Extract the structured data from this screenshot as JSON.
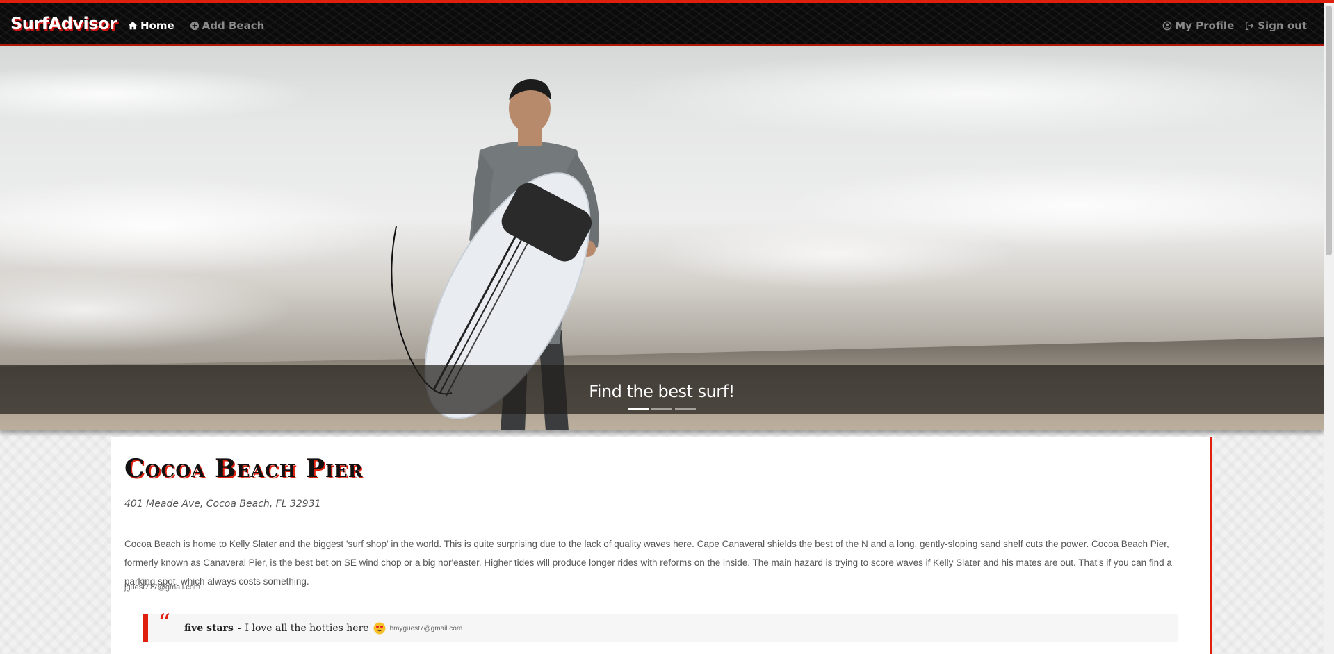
{
  "navbar": {
    "brand": "SurfAdvisor",
    "left_links": [
      {
        "label": "Home",
        "icon": "home-icon",
        "active": true
      },
      {
        "label": "Add Beach",
        "icon": "plus-circle-icon",
        "active": false
      }
    ],
    "right_links": [
      {
        "label": "My Profile",
        "icon": "user-circle-icon"
      },
      {
        "label": "Sign out",
        "icon": "sign-out-icon"
      }
    ]
  },
  "hero": {
    "caption": "Find the best surf!",
    "slides": 3,
    "active_slide": 1
  },
  "beach": {
    "name": "Cocoa Beach Pier",
    "address": "401 Meade Ave, Cocoa Beach, FL 32931",
    "description": "Cocoa Beach is home to Kelly Slater and the biggest 'surf shop' in the world. This is quite surprising due to the lack of quality waves here. Cape Canaveral shields the best of the N and a long, gently-sloping sand shelf cuts the power. Cocoa Beach Pier, formerly known as Canaveral Pier, is the best bet on SE wind chop or a big nor'easter. Higher tides will produce longer rides with reforms on the inside. The main hazard is trying to score waves if Kelly Slater and his mates are out. That's if you can find a parking spot, which always costs something.",
    "posted_by": "jguest777@gmail.com"
  },
  "reviews": [
    {
      "rating": "five stars",
      "separator": " - ",
      "text": "I love all the hotties here",
      "emoji": "heart-eyes-emoji",
      "user": "bmyguest7@gmail.com"
    }
  ],
  "colors": {
    "accent": "#e0200f",
    "navbar_bg": "#0b0b0b"
  }
}
